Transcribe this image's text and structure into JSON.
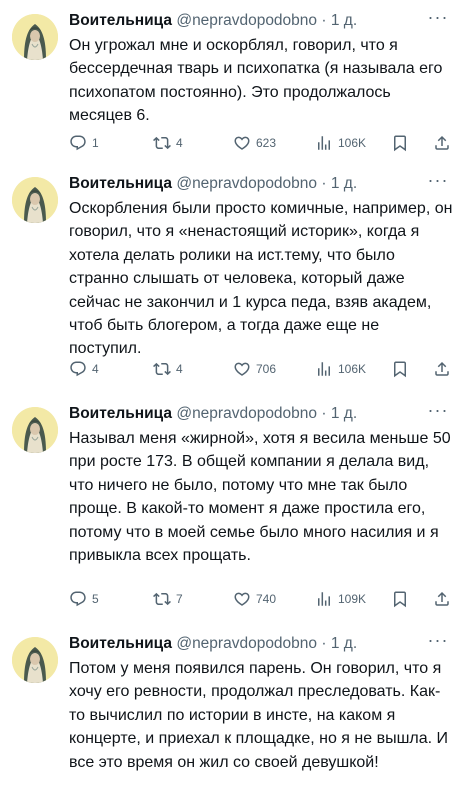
{
  "tweets": [
    {
      "author_name": "Воительница",
      "handle": "@nepravdopodobno",
      "separator": "·",
      "time": "1 д.",
      "text": "Он угрожал мне и оскорблял, говорил, что я бессердечная тварь и психопатка (я называла его психопатом постоянно). Это продолжалось месяцев 6.",
      "replies": "1",
      "retweets": "4",
      "likes": "623",
      "views": "106K"
    },
    {
      "author_name": "Воительница",
      "handle": "@nepravdopodobno",
      "separator": "·",
      "time": "1 д.",
      "text": "Оскорбления  были просто комичные, например, он говорил, что я «ненастоящий историк», когда я хотела делать ролики на ист.тему, что было странно слышать от человека, который даже сейчас не закончил и 1 курса педа, взяв академ, чтоб быть блогером, а тогда даже еще не поступил.",
      "replies": "4",
      "retweets": "4",
      "likes": "706",
      "views": "106K"
    },
    {
      "author_name": "Воительница",
      "handle": "@nepravdopodobno",
      "separator": "·",
      "time": "1 д.",
      "text": "Называл меня «жирной», хотя я весила меньше 50 при росте 173. В общей компании я делала вид, что ничего не было, потому что мне так было проще. В какой-то момент я даже простила его, потому что в моей семье было много насилия и я привыкла всех прощать.",
      "replies": "5",
      "retweets": "7",
      "likes": "740",
      "views": "109K"
    },
    {
      "author_name": "Воительница",
      "handle": "@nepravdopodobno",
      "separator": "·",
      "time": "1 д.",
      "text": "Потом у меня появился парень. Он говорил, что я хочу его ревности, продолжал преследовать. Как-то вычислил по истории в инсте, на каком я концерте, и приехал к площадке, но я не вышла. И все это время он жил со своей девушкой!"
    }
  ],
  "icons": {
    "more": "more-dots-icon",
    "reply": "reply-icon",
    "retweet": "retweet-icon",
    "like": "heart-icon",
    "views": "views-icon",
    "bookmark": "bookmark-icon",
    "share": "share-icon"
  },
  "colors": {
    "text": "#0f1419",
    "secondary": "#536471",
    "avatar_background": "#f3e9a6",
    "background": "#ffffff"
  }
}
